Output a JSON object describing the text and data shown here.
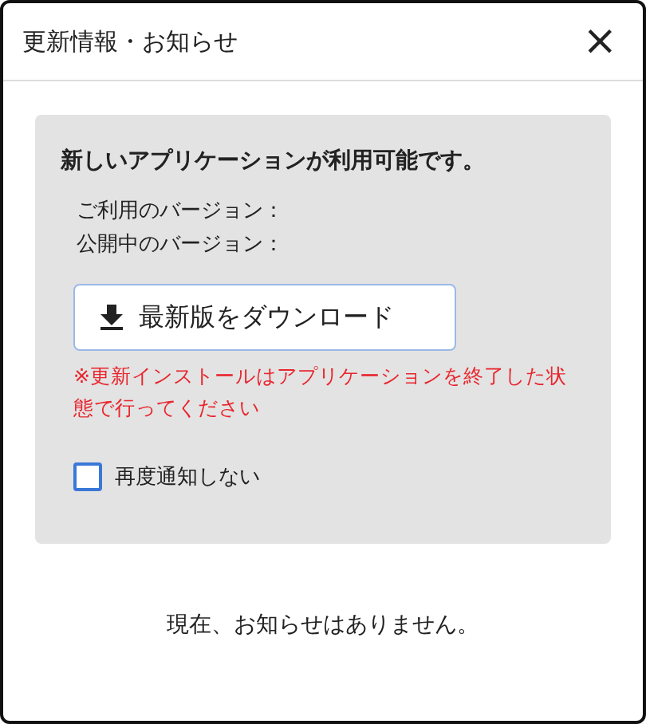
{
  "window": {
    "title": "更新情報・お知らせ",
    "close": "×"
  },
  "update_panel": {
    "heading": "新しいアプリケーションが利用可能です。",
    "versions": [
      "ご利用のバージョン：",
      "公開中のバージョン："
    ],
    "download_button": {
      "label": "最新版をダウンロード"
    },
    "warning": "※更新インストールはアプリケーションを終了した状態で行ってください",
    "dont_notify": {
      "label": "再度通知しない",
      "checked": false
    }
  },
  "notice": "現在、お知らせはありません。"
}
